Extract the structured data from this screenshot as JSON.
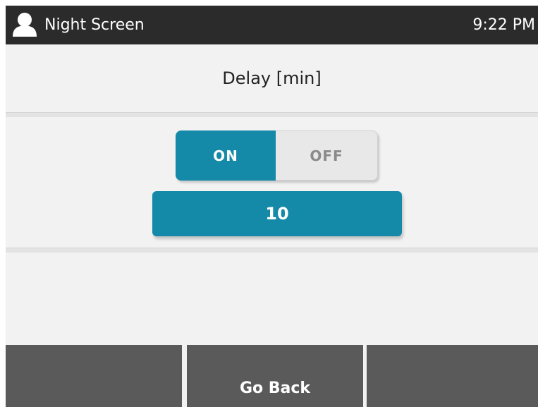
{
  "status_bar": {
    "title": "Night Screen",
    "time": "9:22 PM",
    "user_icon": "user-icon"
  },
  "setting": {
    "label": "Delay [min]",
    "toggle": {
      "on_label": "ON",
      "off_label": "OFF",
      "selected": "ON"
    },
    "value": "10"
  },
  "footer": {
    "left_label": "",
    "center_label": "Go Back",
    "right_label": ""
  },
  "colors": {
    "accent": "#1489a8",
    "status_bar": "#2b2b2b",
    "footer": "#5a5a5a",
    "background": "#f2f2f2"
  }
}
